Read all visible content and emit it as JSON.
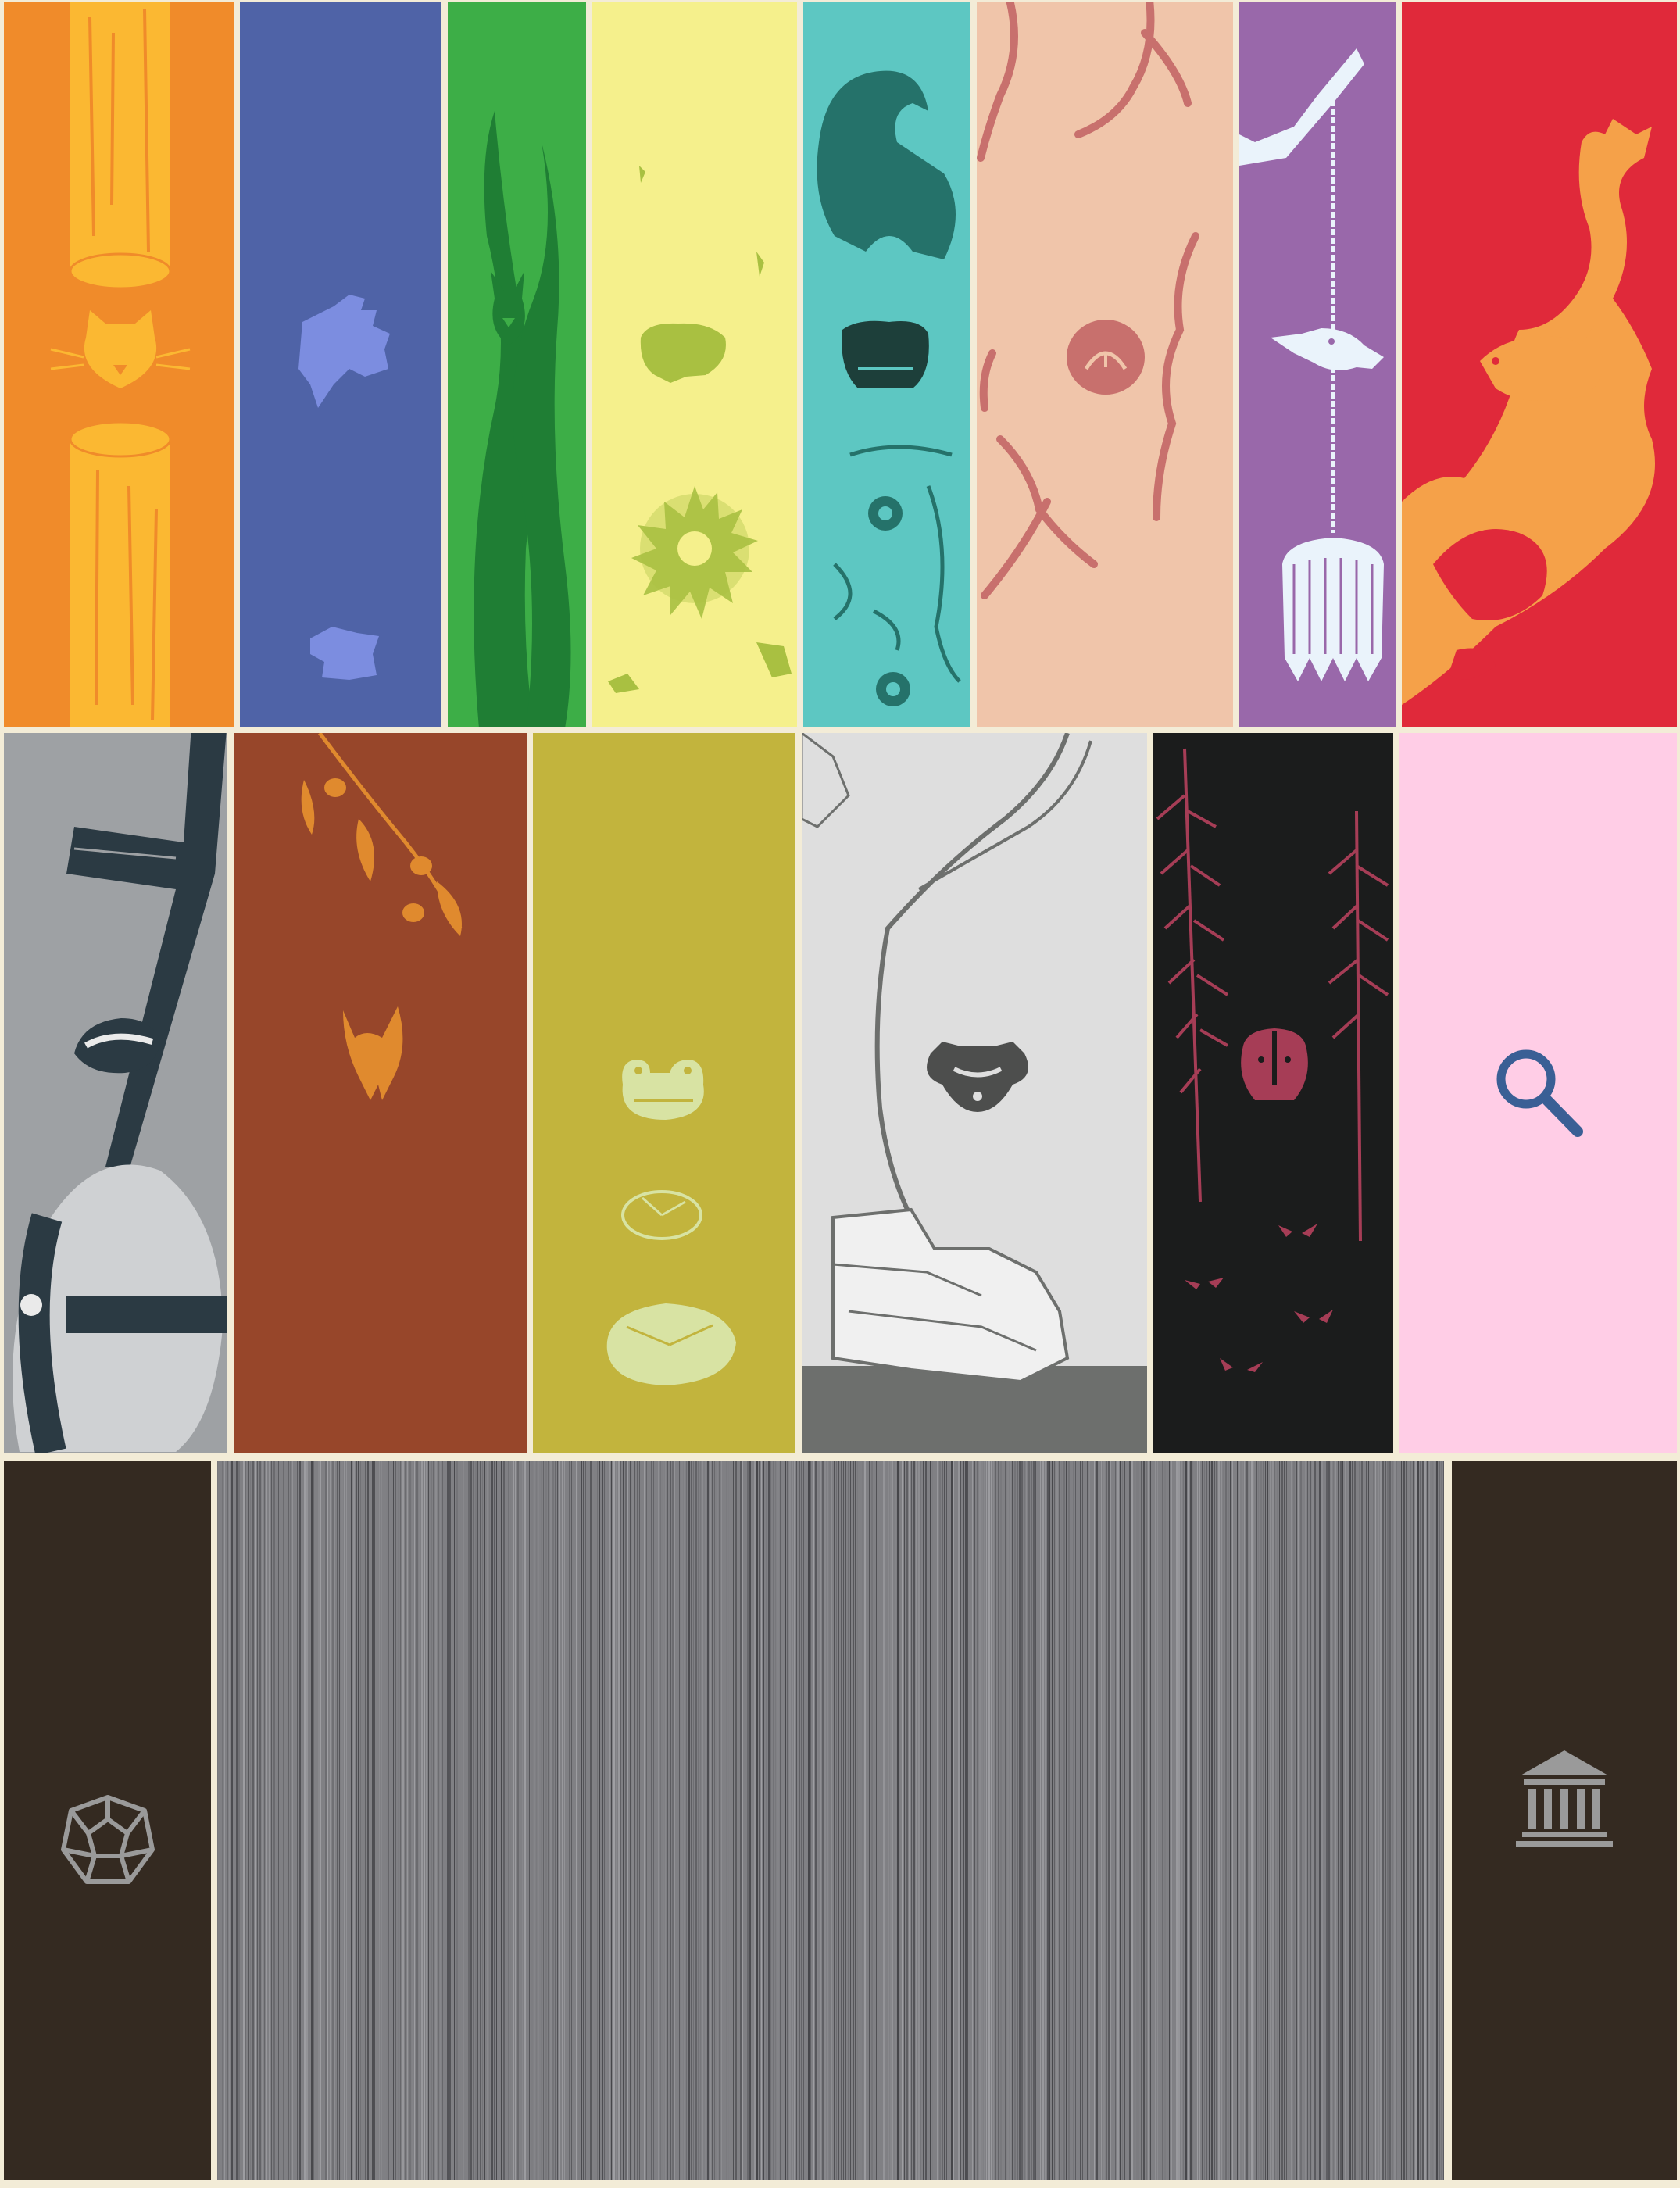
{
  "colors": {
    "frame": "#f3ecd7",
    "row1": [
      "#f08b2a",
      "#4f63a7",
      "#3dae47",
      "#f5f08c",
      "#5dc7c2",
      "#f0c5aa",
      "#9968aa",
      "#e0293a"
    ],
    "row2": [
      "#9ea1a4",
      "#97462a",
      "#c2b43d",
      "#dedede",
      "#1b1c1c",
      "#ffcde6"
    ],
    "row3": [
      "#342a21",
      "#7a7a7a",
      "#342a21"
    ]
  },
  "row1": [
    {
      "icon": "cat-icon",
      "motif": "bamboo-icon"
    },
    {
      "icon": "bird-icon",
      "motif": "feather-icon"
    },
    {
      "icon": "rabbit-icon",
      "motif": "grass-icon"
    },
    {
      "icon": "frog-icon",
      "motif": "flower-icon"
    },
    {
      "icon": "mole-icon",
      "motif": "burrow-icon"
    },
    {
      "icon": "face-icon",
      "motif": "root-icon"
    },
    {
      "icon": "crow-icon",
      "motif": "well-bucket-icon"
    },
    {
      "icon": "fox-icon",
      "motif": "flame-icon"
    }
  ],
  "row2": [
    {
      "icon": "badger-icon",
      "motif": "cross-icon"
    },
    {
      "icon": "bat-icon",
      "motif": "olive-branch-icon"
    },
    {
      "icon": "toad-icon",
      "motif": "lily-pad-icon"
    },
    {
      "icon": "raccoon-icon",
      "motif": "tree-icon"
    },
    {
      "icon": "skunk-icon",
      "motif": "forest-eyes-icon"
    },
    {
      "icon": "search-icon",
      "motif": ""
    }
  ],
  "row3": [
    {
      "icon": "dodecahedron-icon"
    },
    {
      "icon": "book-spines-icon"
    },
    {
      "icon": "museum-icon"
    }
  ]
}
